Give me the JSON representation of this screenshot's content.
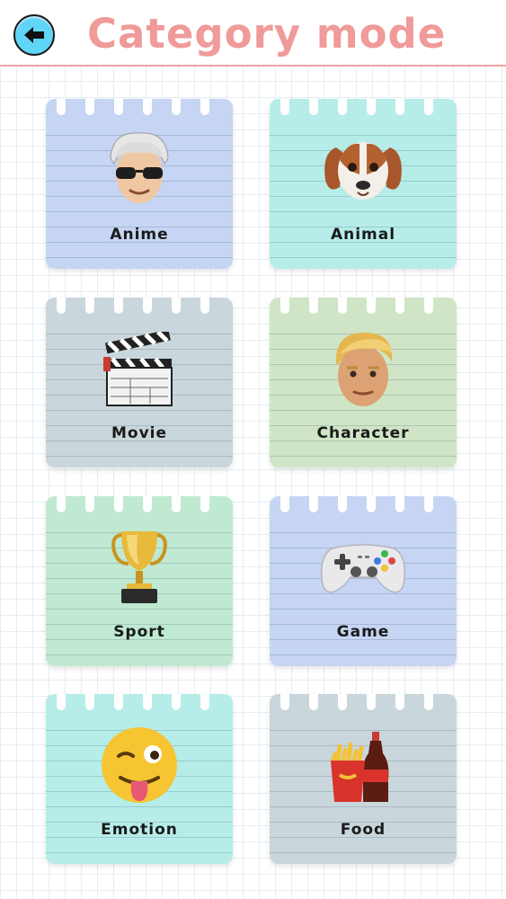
{
  "header": {
    "title": "Category mode",
    "back_icon": "arrow-left-icon"
  },
  "categories": [
    {
      "label": "Anime",
      "icon": "cool-man-face-icon",
      "color": "#c5d5f3"
    },
    {
      "label": "Animal",
      "icon": "dog-face-icon",
      "color": "#b6ede8"
    },
    {
      "label": "Movie",
      "icon": "clapperboard-icon",
      "color": "#c9d6dc"
    },
    {
      "label": "Character",
      "icon": "blonde-man-face-icon",
      "color": "#cfe5c6"
    },
    {
      "label": "Sport",
      "icon": "trophy-icon",
      "color": "#bfe9d1"
    },
    {
      "label": "Game",
      "icon": "gamepad-icon",
      "color": "#c5d5f3"
    },
    {
      "label": "Emotion",
      "icon": "winking-tongue-face-icon",
      "color": "#b6ede8"
    },
    {
      "label": "Food",
      "icon": "fries-and-cola-icon",
      "color": "#c9d6dc"
    }
  ]
}
